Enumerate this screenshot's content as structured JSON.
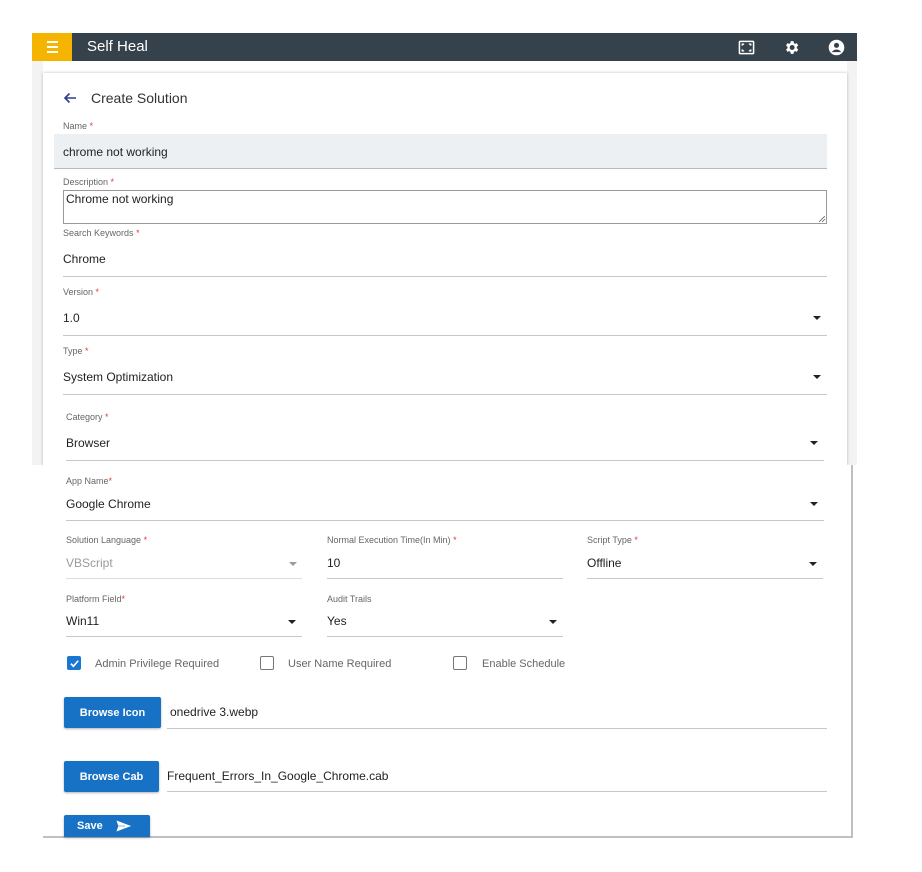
{
  "app": {
    "title": "Self Heal"
  },
  "icons": {
    "menu": "menu-icon",
    "fullscreen": "fullscreen-icon",
    "settings": "gear-icon",
    "account": "account-icon",
    "back": "arrow-left-icon"
  },
  "colors": {
    "topbar": "#36424b",
    "menu_accent": "#f5b400",
    "primary": "#1771c5",
    "required": "#e53935"
  },
  "page": {
    "title": "Create Solution"
  },
  "form": {
    "name": {
      "label": "Name",
      "required": "*",
      "value": "chrome not working"
    },
    "description": {
      "label": "Description",
      "required": "*",
      "value": "Chrome not working"
    },
    "keywords": {
      "label": "Search Keywords",
      "required": "*",
      "value": "Chrome"
    },
    "version": {
      "label": "Version",
      "required": "*",
      "value": "1.0"
    },
    "type": {
      "label": "Type",
      "required": "*",
      "value": "System Optimization"
    },
    "category": {
      "label": "Category",
      "required": "*",
      "value": "Browser"
    },
    "app_name": {
      "label": "App Name",
      "required": "*",
      "value": "Google Chrome"
    },
    "solution_language": {
      "label": "Solution Language",
      "required": "*",
      "value": "VBScript"
    },
    "exec_time": {
      "label": "Normal Execution Time(In Min)",
      "required": "*",
      "value": "10"
    },
    "script_type": {
      "label": "Script Type",
      "required": "*",
      "value": "Offline"
    },
    "platform": {
      "label": "Platform Field",
      "required": "*",
      "value": "Win11"
    },
    "audit": {
      "label": "Audit Trails",
      "value": "Yes"
    },
    "checkboxes": {
      "admin": {
        "label": "Admin Privilege Required",
        "checked": true
      },
      "username": {
        "label": "User Name Required",
        "checked": false
      },
      "schedule": {
        "label": "Enable Schedule",
        "checked": false
      }
    },
    "browse_icon": {
      "button": "Browse Icon",
      "file": "onedrive 3.webp"
    },
    "browse_cab": {
      "button": "Browse Cab",
      "file": "Frequent_Errors_In_Google_Chrome.cab"
    },
    "save": {
      "label": "Save"
    }
  }
}
